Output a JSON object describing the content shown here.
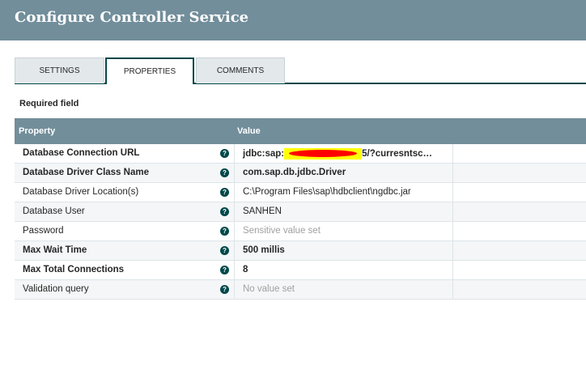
{
  "dialog": {
    "title": "Configure Controller Service"
  },
  "tabs": [
    {
      "label": "SETTINGS"
    },
    {
      "label": "PROPERTIES",
      "active": true
    },
    {
      "label": "COMMENTS"
    }
  ],
  "required_label": "Required field",
  "table": {
    "headers": {
      "property": "Property",
      "value": "Value"
    },
    "rows": [
      {
        "name": "Database Connection URL",
        "value_start": "jdbc:sap:",
        "value_end": "5/?curresntsc…",
        "required": true,
        "redacted": true
      },
      {
        "name": "Database Driver Class Name",
        "value": "com.sap.db.jdbc.Driver",
        "required": true
      },
      {
        "name": "Database Driver Location(s)",
        "value": "C:\\Program Files\\sap\\hdbclient\\ngdbc.jar",
        "required": false
      },
      {
        "name": "Database User",
        "value": "SANHEN",
        "required": false
      },
      {
        "name": "Password",
        "value": "Sensitive value set",
        "required": false,
        "placeholder": true
      },
      {
        "name": "Max Wait Time",
        "value": "500 millis",
        "required": true
      },
      {
        "name": "Max Total Connections",
        "value": "8",
        "required": true
      },
      {
        "name": "Validation query",
        "value": "No value set",
        "required": false,
        "placeholder": true
      }
    ],
    "help_icon": "?"
  },
  "colors": {
    "header": "#728e9b",
    "accent": "#004849"
  }
}
